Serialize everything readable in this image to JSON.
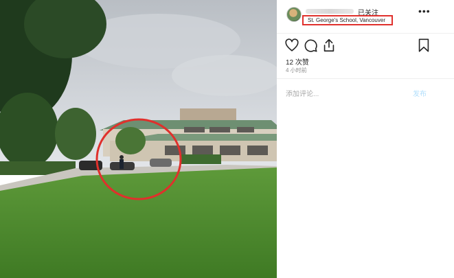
{
  "post": {
    "follow_label": "已关注",
    "more_label": "•••",
    "location": "St. George's School, Vancouver",
    "likes": "12 次赞",
    "time": "4 小时前",
    "comment_placeholder": "添加评论...",
    "post_label": "发布"
  },
  "icons": {
    "like": "heart-icon",
    "comment": "speech-bubble-icon",
    "share": "share-upload-icon",
    "save": "bookmark-icon"
  },
  "colors": {
    "highlight_border": "#e0302c",
    "post_button": "#b2dffc",
    "secondary_text": "#8e8e8e"
  }
}
